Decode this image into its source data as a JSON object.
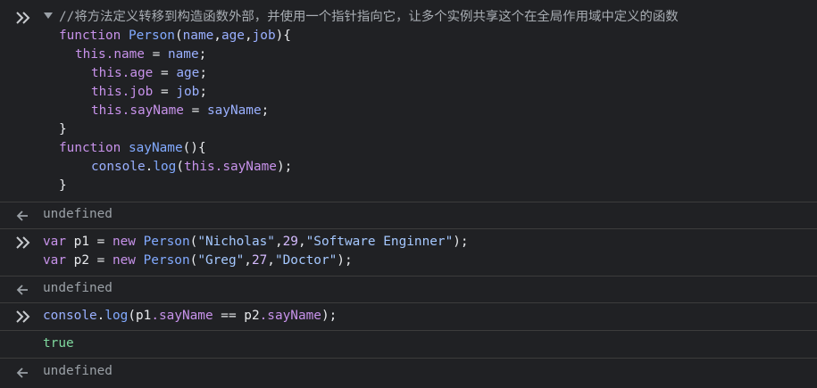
{
  "entries": {
    "e1": {
      "comment": "//将方法定义转移到构造函数外部，并使用一个指针指向它，让多个实例共享这个在全局作用域中定义的函数",
      "l1": {
        "kw": "function",
        "fn": "Person",
        "p1": "(",
        "a1": "name",
        "c1": ",",
        "a2": "age",
        "c2": ",",
        "a3": "job",
        "p2": "){"
      },
      "l2": {
        "this": "this",
        "prop": ".name",
        "eq": " = ",
        "val": "name",
        "end": ";"
      },
      "l3": {
        "this": "this",
        "prop": ".age",
        "eq": " = ",
        "val": "age",
        "end": ";"
      },
      "l4": {
        "this": "this",
        "prop": ".job",
        "eq": " = ",
        "val": "job",
        "end": ";"
      },
      "l5": {
        "this": "this",
        "prop": ".sayName",
        "eq": " = ",
        "val": "sayName",
        "end": ";"
      },
      "l6": "}",
      "l7": {
        "kw": "function",
        "fn": "sayName",
        "p": "(){"
      },
      "l8": {
        "obj": "console",
        "dot": ".",
        "m": "log",
        "p1": "(",
        "this": "this",
        "prop": ".sayName",
        "p2": ");"
      },
      "l9": "}"
    },
    "r1": "undefined",
    "e2": {
      "l1": {
        "kw": "var",
        "name": " p1 = ",
        "new": "new",
        "cls": " Person",
        "p1": "(",
        "s1": "\"Nicholas\"",
        "c1": ",",
        "n": "29",
        "c2": ",",
        "s2": "\"Software Enginner\"",
        "p2": ");"
      },
      "l2": {
        "kw": "var",
        "name": " p2 = ",
        "new": "new",
        "cls": " Person",
        "p1": "(",
        "s1": "\"Greg\"",
        "c1": ",",
        "n": "27",
        "c2": ",",
        "s2": "\"Doctor\"",
        "p2": ");"
      }
    },
    "r2": "undefined",
    "e3": {
      "l1": {
        "obj": "console",
        "dot": ".",
        "m": "log",
        "p1": "(",
        "a": "p1",
        "prop1": ".sayName",
        "op": " == ",
        "b": "p2",
        "prop2": ".sayName",
        "p2": ");"
      }
    },
    "r3": "true",
    "r4": "undefined"
  },
  "colors": {
    "background": "#202124",
    "keyword": "#c792ea",
    "function_name": "#82aaff",
    "string": "#a5c8ff",
    "comment": "#a8adb3",
    "undefined": "#9aa0a6",
    "true_value": "#7fd89e"
  },
  "icons": {
    "prompt": "double-chevron-right-icon",
    "result": "arrow-left-icon",
    "toggle": "triangle-down-icon"
  }
}
